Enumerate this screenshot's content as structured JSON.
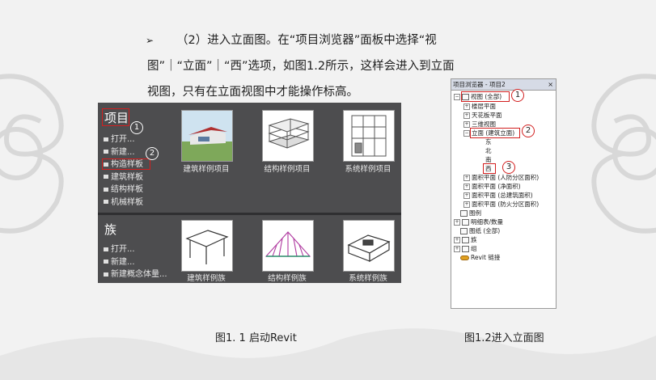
{
  "paragraph": {
    "bullet": "➢",
    "line1": "（2）进入立面图。在“项目浏览器”面板中选择“视",
    "line2": "图”｜“立面”｜“西”选项，如图1.2所示，这样会进入到立面",
    "line3": "视图，只有在立面视图中才能操作标高。"
  },
  "start_screen": {
    "project_section": {
      "title": "项目",
      "menu": [
        "打开...",
        "新建...",
        "构造样板",
        "建筑样板",
        "结构样板",
        "机械样板"
      ],
      "thumbnails": [
        "建筑样例项目",
        "结构样例项目",
        "系统样例项目"
      ]
    },
    "family_section": {
      "title": "族",
      "menu": [
        "打开...",
        "新建...",
        "新建概念体量..."
      ],
      "thumbnails": [
        "建筑样例族",
        "结构样例族",
        "系统样例族"
      ]
    },
    "callouts": [
      "1",
      "2"
    ]
  },
  "project_browser": {
    "title": "项目浏览器 - 项目2",
    "close": "×",
    "tree": [
      {
        "label": "视图 (全部)",
        "level": 0,
        "toggle": "−"
      },
      {
        "label": "楼层平面",
        "level": 1,
        "toggle": "+"
      },
      {
        "label": "天花板平面",
        "level": 1,
        "toggle": "+"
      },
      {
        "label": "三维视图",
        "level": 1,
        "toggle": "+"
      },
      {
        "label": "立面 (建筑立面)",
        "level": 1,
        "toggle": "−"
      },
      {
        "label": "东",
        "level": 2,
        "toggle": ""
      },
      {
        "label": "北",
        "level": 2,
        "toggle": ""
      },
      {
        "label": "南",
        "level": 2,
        "toggle": ""
      },
      {
        "label": "西",
        "level": 2,
        "toggle": ""
      },
      {
        "label": "面积平面 (人防分区面积)",
        "level": 1,
        "toggle": "+"
      },
      {
        "label": "面积平面 (净面积)",
        "level": 1,
        "toggle": "+"
      },
      {
        "label": "面积平面 (总建筑面积)",
        "level": 1,
        "toggle": "+"
      },
      {
        "label": "面积平面 (防火分区面积)",
        "level": 1,
        "toggle": "+"
      },
      {
        "label": "图例",
        "level": 0,
        "toggle": ""
      },
      {
        "label": "明细表/数量",
        "level": 0,
        "toggle": "+"
      },
      {
        "label": "图纸 (全部)",
        "level": 0,
        "toggle": ""
      },
      {
        "label": "族",
        "level": 0,
        "toggle": "+"
      },
      {
        "label": "组",
        "level": 0,
        "toggle": "+"
      },
      {
        "label": "Revit 链接",
        "level": 0,
        "toggle": ""
      }
    ],
    "callouts": [
      "1",
      "2",
      "3"
    ]
  },
  "captions": {
    "left": "图1. 1  启动Revit",
    "right": "图1.2进入立面图"
  }
}
